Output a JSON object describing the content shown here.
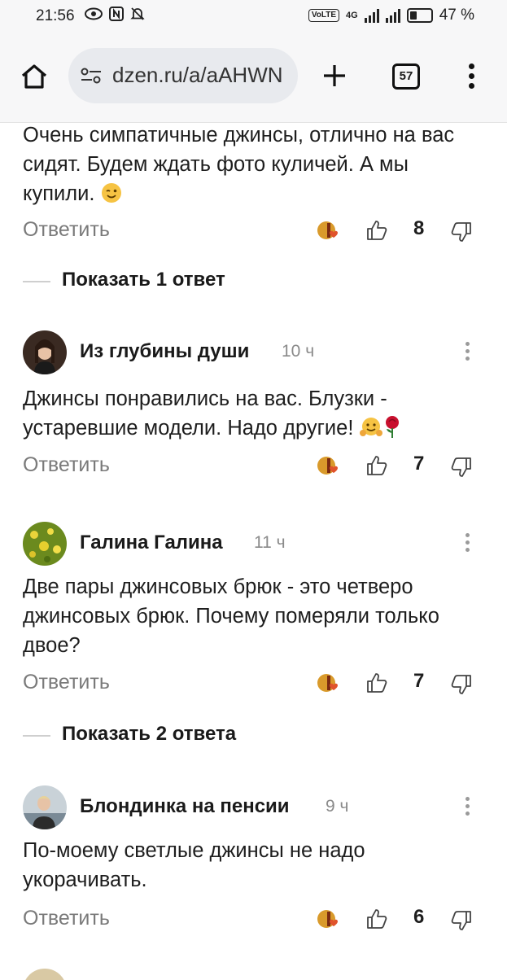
{
  "status_bar": {
    "time": "21:56",
    "battery": "47 %",
    "volte_label": "VoLTE",
    "network": "4G",
    "icons": [
      "eye-icon",
      "nfc-icon",
      "mute-bell-icon",
      "signal-icon",
      "battery-icon"
    ]
  },
  "browser": {
    "url": "dzen.ru/a/aAHWN",
    "tab_count": "57",
    "icons": [
      "home-icon",
      "site-settings-icon",
      "new-tab-plus-icon",
      "tabs-icon",
      "more-menu-icon"
    ]
  },
  "comments_header_partial": {
    "text": "Очень симпатичные джинсы, отлично на вас сидят. Будем ждать фото куличей. А мы купили.",
    "emoji": "winking-face-icon",
    "reply_label": "Ответить",
    "likes": "8",
    "show_replies": "Показать 1 ответ"
  },
  "comments": [
    {
      "author": "Из глубины души",
      "time": "10 ч",
      "text": "Джинсы понравились на вас. Блузки - устаревшие модели. Надо другие!",
      "emojis": [
        "hugging-face-icon",
        "rose-icon"
      ],
      "reply_label": "Ответить",
      "likes": "7"
    },
    {
      "author": "Галина Галина",
      "time": "11 ч",
      "text": "Две пары джинсовых брюк - это четверо джинсовых брюк. Почему померяли только двое?",
      "reply_label": "Ответить",
      "likes": "7",
      "show_replies": "Показать 2 ответа"
    },
    {
      "author": "Блондинка на пенсии",
      "time": "9 ч",
      "text": "По-моему светлые джинсы не надо укорачивать.",
      "reply_label": "Ответить",
      "likes": "6"
    }
  ],
  "colors": {
    "toolbar_bg": "#f7f7f8",
    "urlbar_bg": "#e8eaee",
    "muted_text": "#7a7a7a",
    "text": "#1e1e1e"
  }
}
